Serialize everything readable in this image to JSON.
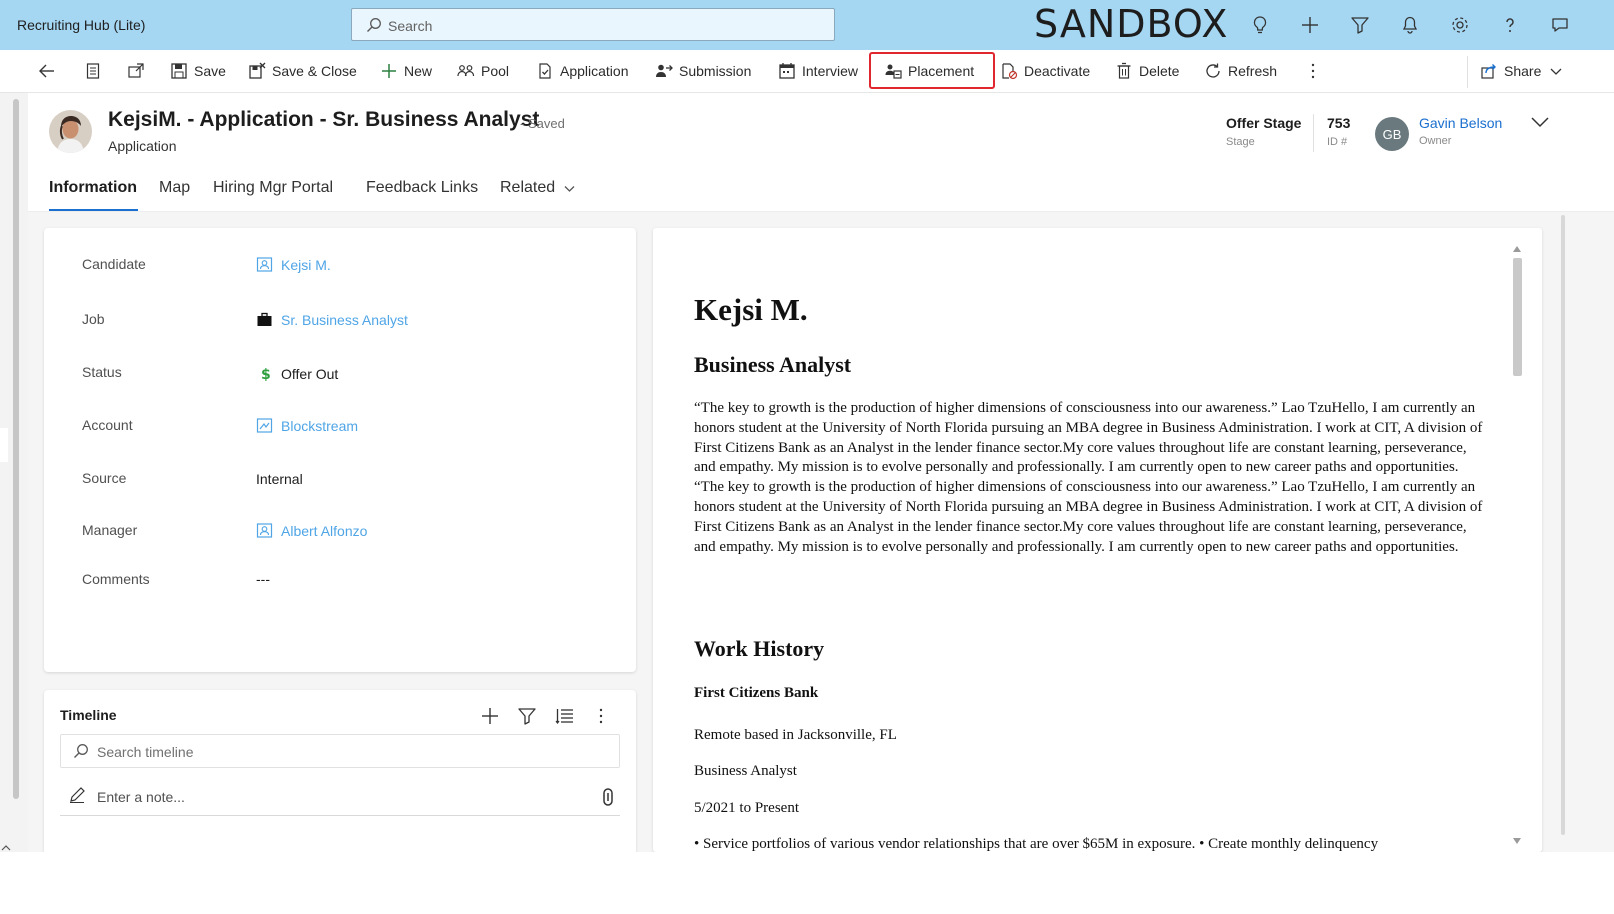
{
  "topbar": {
    "app_title": "Recruiting Hub (Lite)",
    "search_placeholder": "Search",
    "environment": "SANDBOX",
    "icons": [
      "lightbulb-icon",
      "plus-icon",
      "filter-icon",
      "bell-icon",
      "gear-icon",
      "help-icon",
      "chat-icon"
    ]
  },
  "commandbar": {
    "save": "Save",
    "save_close": "Save & Close",
    "new": "New",
    "pool": "Pool",
    "application": "Application",
    "submission": "Submission",
    "interview": "Interview",
    "placement": "Placement",
    "deactivate": "Deactivate",
    "delete": "Delete",
    "refresh": "Refresh",
    "share": "Share"
  },
  "header": {
    "title": "KejsiM. - Application - Sr. Business Analyst",
    "saved_state": "- Saved",
    "entity": "Application",
    "stage_value": "Offer Stage",
    "stage_label": "Stage",
    "id_value": "753",
    "id_label": "ID #",
    "owner_initials": "GB",
    "owner_name": "Gavin Belson",
    "owner_label": "Owner"
  },
  "tabs": [
    "Information",
    "Map",
    "Hiring Mgr Portal",
    "Feedback Links",
    "Related"
  ],
  "form": {
    "candidate_label": "Candidate",
    "candidate_value": "Kejsi M.",
    "job_label": "Job",
    "job_value": "Sr. Business Analyst",
    "status_label": "Status",
    "status_value": "Offer Out",
    "account_label": "Account",
    "account_value": "Blockstream",
    "source_label": "Source",
    "source_value": "Internal",
    "manager_label": "Manager",
    "manager_value": "Albert Alfonzo",
    "comments_label": "Comments",
    "comments_value": "---"
  },
  "timeline": {
    "title": "Timeline",
    "search_placeholder": "Search timeline",
    "note_placeholder": "Enter a note..."
  },
  "document": {
    "name": "Kejsi M.",
    "role": "Business Analyst",
    "bio": "“The key to growth is the production of higher dimensions of consciousness into our awareness.” Lao TzuHello, I am currently an honors student at the University of North Florida pursuing an MBA degree in Business Administration. I work at CIT, A division of First Citizens Bank as an Analyst in the lender finance sector.My core values throughout life are constant learning, perseverance, and empathy. My mission is to evolve personally and professionally. I am currently open to new career paths and opportunities. “The key to growth is the production of higher dimensions of consciousness into our awareness.” Lao TzuHello, I am currently an honors student at the University of North Florida pursuing an MBA degree in Business Administration. I work at CIT, A division of First Citizens Bank as an Analyst in the lender finance sector.My core values throughout life are constant learning, perseverance, and empathy. My mission is to evolve personally and professionally. I am currently open to new career paths and opportunities.",
    "work_history_heading": "Work History",
    "company": "First Citizens Bank",
    "location": "Remote based in Jacksonville, FL",
    "position": "Business Analyst",
    "dates": "5/2021 to Present",
    "duties_partial": "• Service portfolios of various vendor relationships that are over $65M in exposure. • Create monthly delinquency"
  },
  "colors": {
    "topbar_bg": "#a5d6f2",
    "link": "#4fa5e6",
    "accent": "#1a6fcf",
    "highlight_box": "#e0262f",
    "status_icon": "#2e9e3f"
  }
}
